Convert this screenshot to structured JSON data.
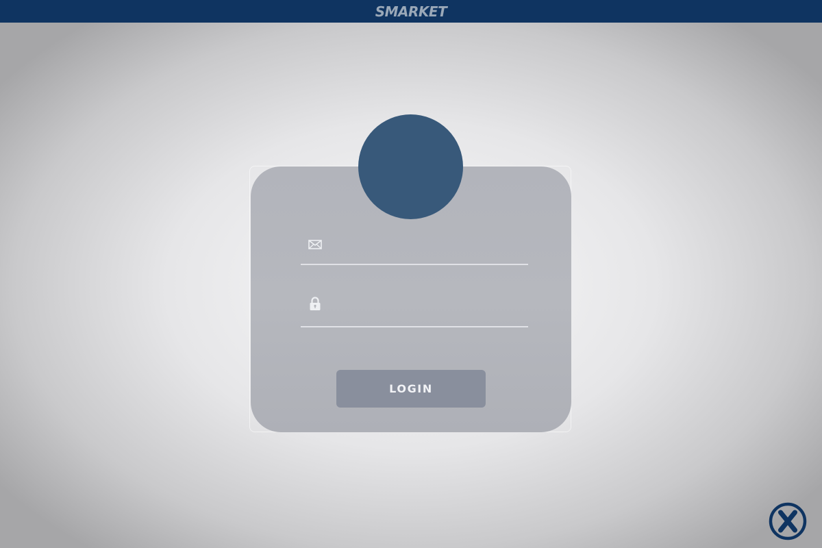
{
  "app": {
    "brand": "SMARKET"
  },
  "login": {
    "email": {
      "icon": "envelope-icon",
      "value": "",
      "placeholder": ""
    },
    "password": {
      "icon": "lock-icon",
      "value": "",
      "placeholder": ""
    },
    "button_label": "LOGIN"
  },
  "corner_button": {
    "icon": "close-circle-icon"
  },
  "colors": {
    "topbar": "#0f3461",
    "brand_text": "#9aa8b8",
    "card": "#b4b6bc",
    "avatar": "#38597a",
    "button": "#898f9d",
    "close_icon": "#0f3461"
  }
}
